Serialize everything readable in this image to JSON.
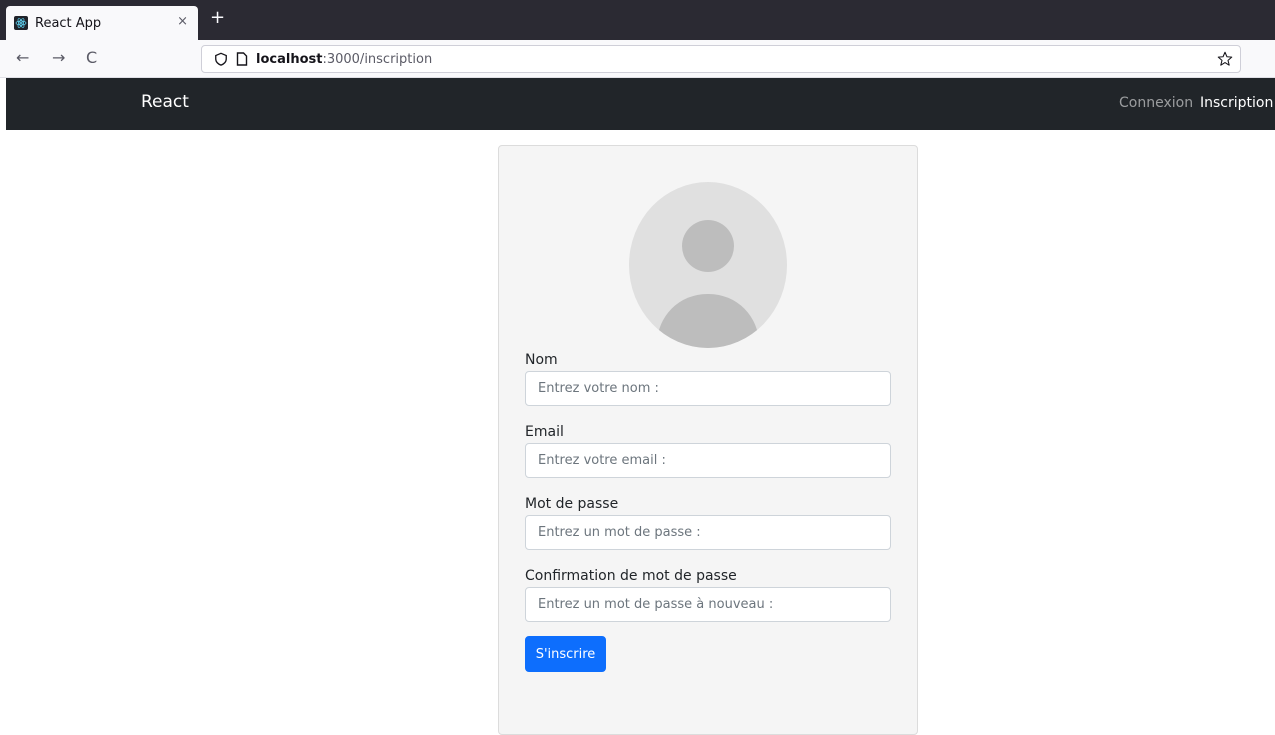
{
  "browser": {
    "tab_title": "React App",
    "tab_close": "×",
    "new_tab": "+",
    "back": "←",
    "forward": "→",
    "reload": "C",
    "url_host": "localhost",
    "url_path": ":3000/inscription"
  },
  "navbar": {
    "brand": "React",
    "links": [
      "Connexion",
      "Inscription"
    ],
    "active_link": "Inscription"
  },
  "form": {
    "fields": [
      {
        "label": "Nom",
        "placeholder": "Entrez votre nom :",
        "value": ""
      },
      {
        "label": "Email",
        "placeholder": "Entrez votre email :",
        "value": ""
      },
      {
        "label": "Mot de passe",
        "placeholder": "Entrez un mot de passe :",
        "value": ""
      },
      {
        "label": "Confirmation de mot de passe",
        "placeholder": "Entrez un mot de passe à nouveau :",
        "value": ""
      }
    ],
    "submit_label": "S'inscrire"
  },
  "colors": {
    "navbar_bg": "#212529",
    "primary": "#0d6efd",
    "card_bg": "#f5f5f5",
    "avatar_bg": "#e0e0e0",
    "avatar_fg": "#bdbdbd"
  },
  "icons": {
    "favicon": "react-logo-icon",
    "shield": "shield-icon",
    "page": "page-icon",
    "bookmark": "star-icon"
  }
}
